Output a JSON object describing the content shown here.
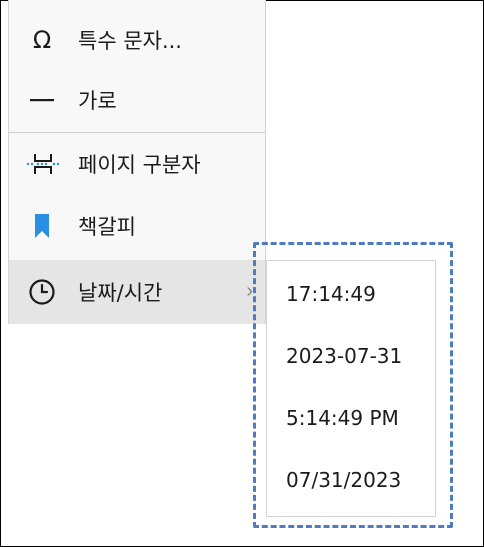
{
  "menu": {
    "items": [
      {
        "label": "특수 문자...",
        "icon": "omega-icon"
      },
      {
        "label": "가로",
        "icon": "horizontal-line-icon"
      },
      {
        "label": "페이지 구분자",
        "icon": "page-break-icon"
      },
      {
        "label": "책갈피",
        "icon": "bookmark-icon"
      },
      {
        "label": "날짜/시간",
        "icon": "clock-icon",
        "chevron": "›"
      }
    ]
  },
  "submenu": {
    "items": [
      {
        "label": "17:14:49"
      },
      {
        "label": "2023-07-31"
      },
      {
        "label": "5:14:49 PM"
      },
      {
        "label": "07/31/2023"
      }
    ]
  },
  "colors": {
    "highlight": "#4d7cbf",
    "bookmark": "#2a8fe0",
    "hover": "#e5e5e5"
  }
}
